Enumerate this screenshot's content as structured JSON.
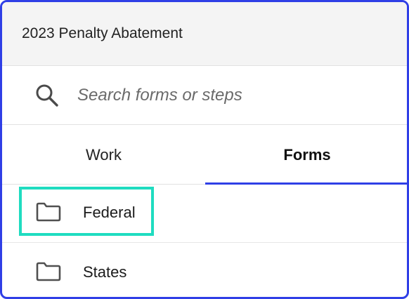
{
  "header": {
    "title": "2023 Penalty Abatement"
  },
  "search": {
    "placeholder": "Search forms or steps",
    "value": ""
  },
  "tabs": [
    {
      "label": "Work",
      "active": false
    },
    {
      "label": "Forms",
      "active": true
    }
  ],
  "list": {
    "items": [
      {
        "label": "Federal",
        "icon": "folder-icon",
        "highlighted": true
      },
      {
        "label": "States",
        "icon": "folder-icon",
        "highlighted": false
      }
    ]
  },
  "colors": {
    "accent": "#2f3fe6",
    "highlight": "#1fdcc0",
    "header_bg": "#f4f4f4"
  }
}
